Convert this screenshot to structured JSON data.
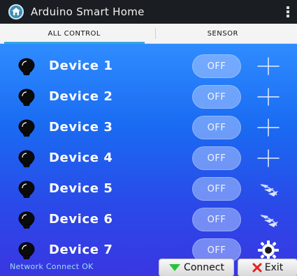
{
  "app": {
    "title": "Arduino Smart Home"
  },
  "tabs": [
    {
      "label": "ALL CONTROL",
      "active": true
    },
    {
      "label": "SENSOR",
      "active": false
    }
  ],
  "devices": [
    {
      "name": "Device 1",
      "state": "OFF",
      "control_icon": "plus-icon"
    },
    {
      "name": "Device 2",
      "state": "OFF",
      "control_icon": "plus-icon"
    },
    {
      "name": "Device 3",
      "state": "OFF",
      "control_icon": "plus-icon"
    },
    {
      "name": "Device 4",
      "state": "OFF",
      "control_icon": "plus-icon"
    },
    {
      "name": "Device 5",
      "state": "OFF",
      "control_icon": "fan-icon"
    },
    {
      "name": "Device 6",
      "state": "OFF",
      "control_icon": "fan-icon"
    },
    {
      "name": "Device 7",
      "state": "OFF",
      "control_icon": "gear-bulb-icon"
    }
  ],
  "footer": {
    "status": "Network Connect OK",
    "connect_label": "Connect",
    "exit_label": "Exit"
  },
  "colors": {
    "accent": "#35a7d8",
    "background_top": "#2f8cff",
    "background_bottom": "#3a36e2",
    "toggle_off": "#afc8ff"
  }
}
